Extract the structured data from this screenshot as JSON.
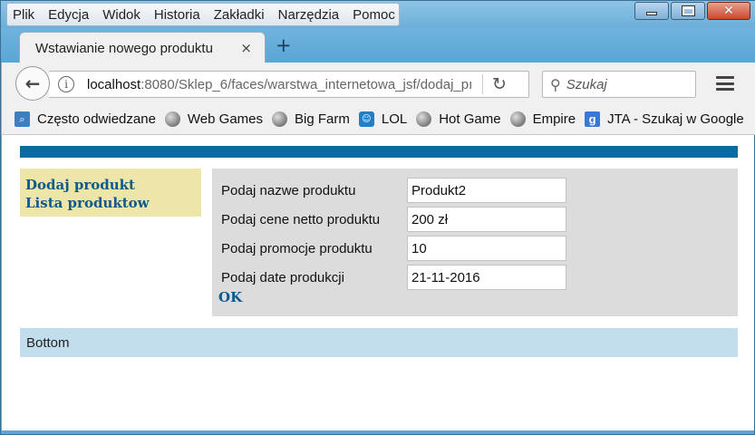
{
  "menubar": {
    "items": [
      "Plik",
      "Edycja",
      "Widok",
      "Historia",
      "Zakładki",
      "Narzędzia",
      "Pomoc"
    ]
  },
  "tab": {
    "title": "Wstawianie nowego produktu",
    "close": "×",
    "new_tab": "+"
  },
  "navbar": {
    "url_host": "localhost",
    "url_rest": ":8080/Sklep_6/faces/warstwa_internetowa_jsf/dodaj_pı",
    "search_placeholder": "Szukaj"
  },
  "bookmarks": [
    {
      "label": "Często odwiedzane",
      "icon": "often-visited-icon"
    },
    {
      "label": "Web Games",
      "icon": "globe-icon"
    },
    {
      "label": "Big Farm",
      "icon": "globe-icon"
    },
    {
      "label": "LOL",
      "icon": "lol-icon"
    },
    {
      "label": "Hot Game",
      "icon": "globe-icon"
    },
    {
      "label": "Empire",
      "icon": "globe-icon"
    },
    {
      "label": "JTA - Szukaj w Google",
      "icon": "google-icon"
    }
  ],
  "page": {
    "left_menu": {
      "add_product": "Dodaj produkt",
      "product_list": "Lista produktow"
    },
    "form": {
      "name_label": "Podaj nazwe produktu",
      "name_value": "Produkt2",
      "price_label": "Podaj cene netto produktu",
      "price_value": "200 zł",
      "promo_label": "Podaj promocje produktu",
      "promo_value": "10",
      "date_label": "Podaj date produkcji",
      "date_value": "21-11-2016",
      "ok_label": "OK"
    },
    "bottom": "Bottom"
  },
  "colors": {
    "top_bar": "#0b6aa0",
    "left_menu_bg": "#eee6a8",
    "form_bg": "#dcdcdc",
    "bottom_bg": "#c2deec",
    "link": "#0b5a8e"
  }
}
